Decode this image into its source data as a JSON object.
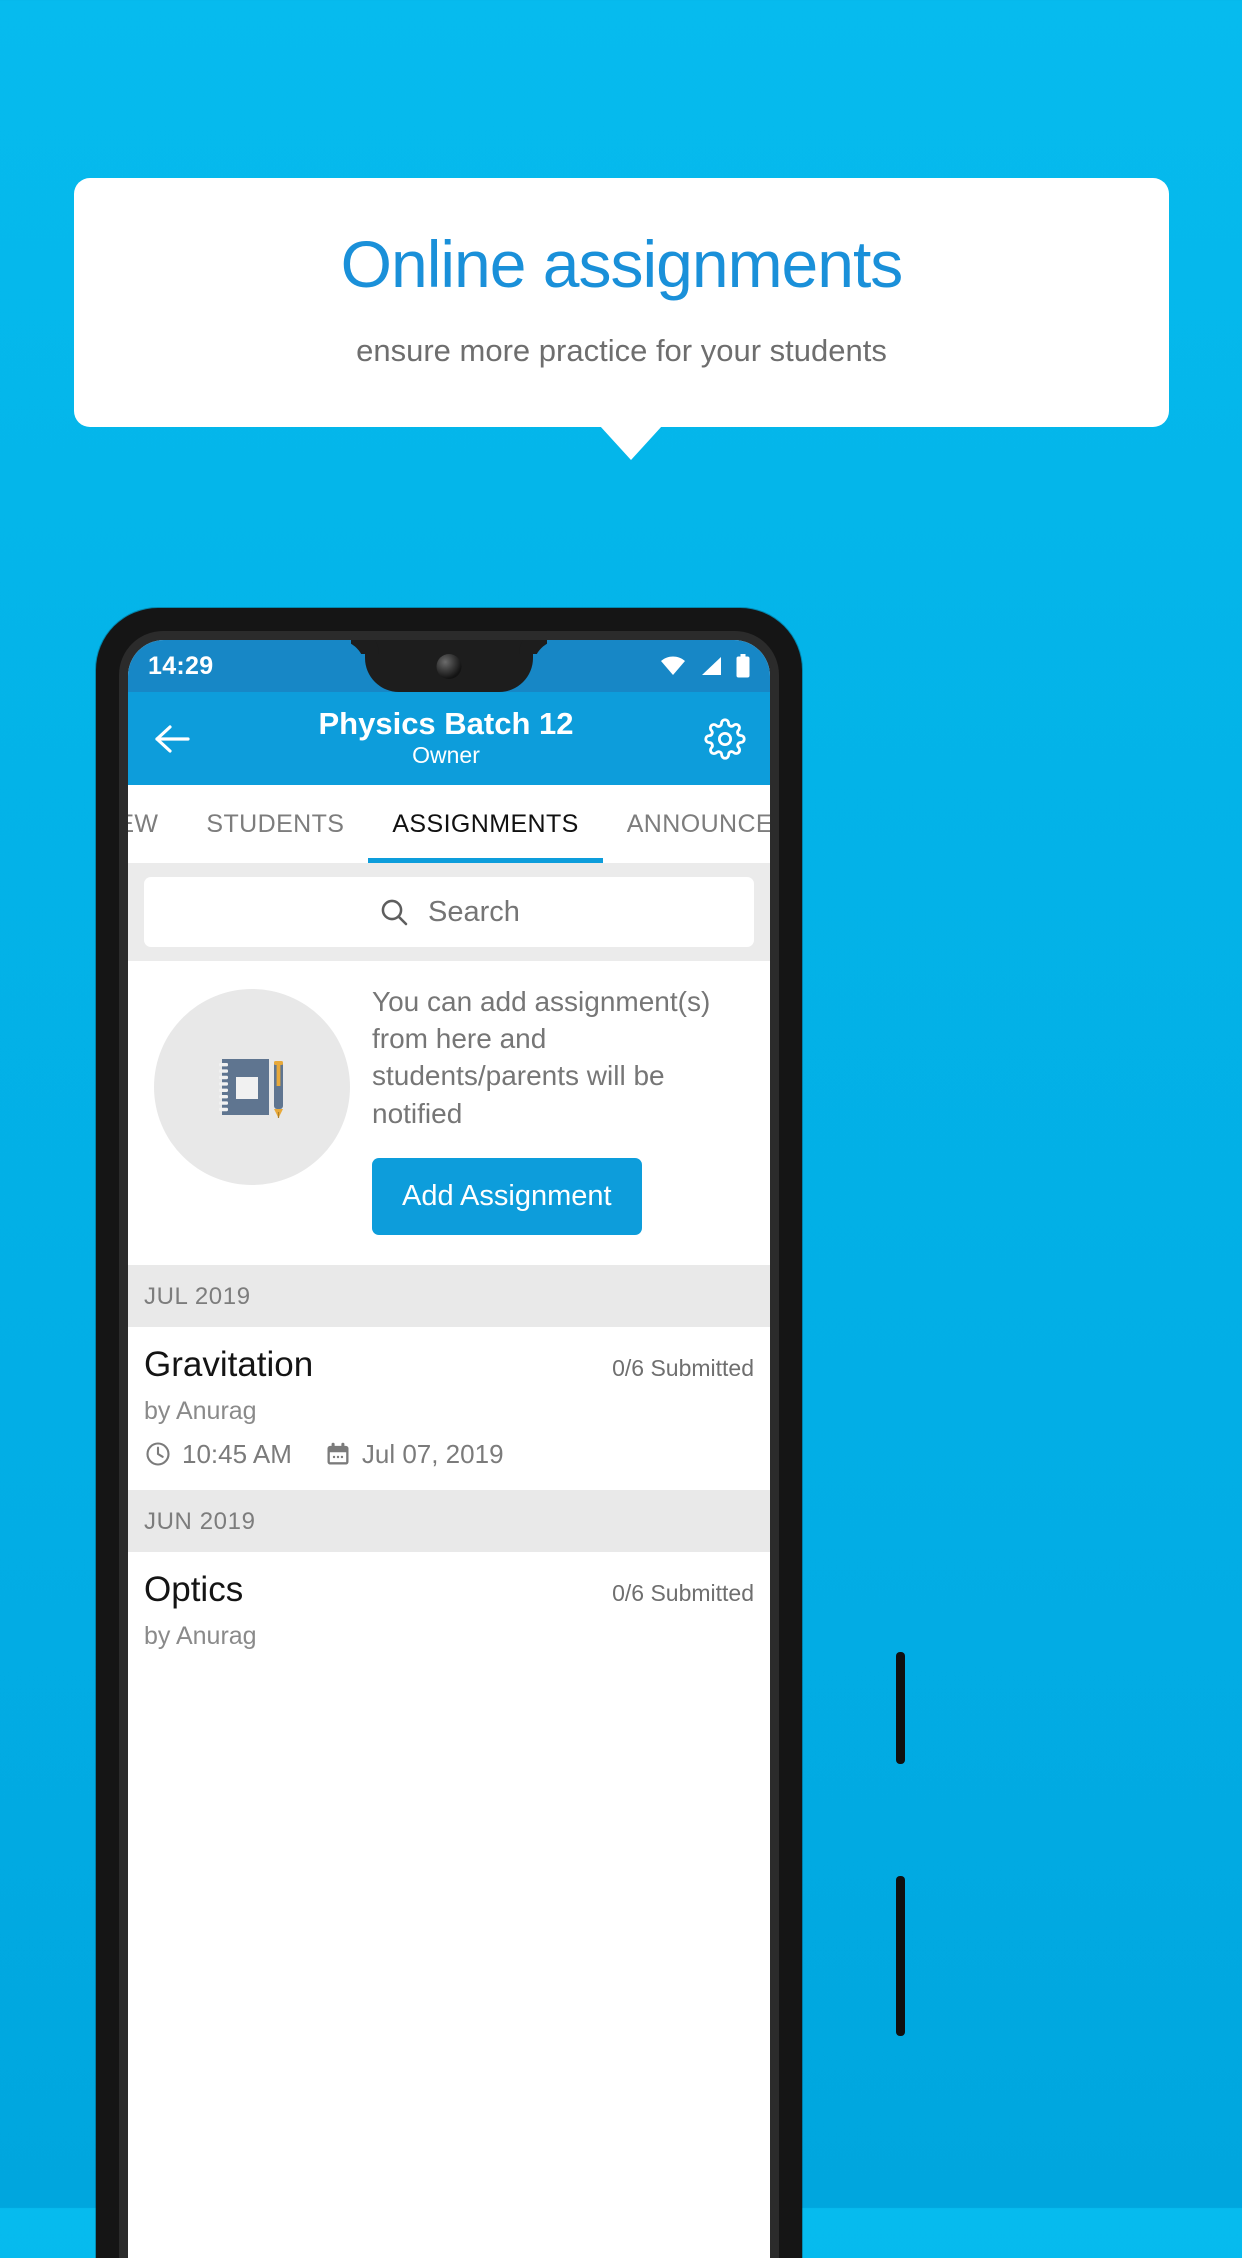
{
  "promo": {
    "title": "Online assignments",
    "subtitle": "ensure more practice for your students"
  },
  "colors": {
    "background": "#03b3e8",
    "accent": "#0d9ddb",
    "promo_title": "#1a90d9",
    "status_bar": "#1787c6",
    "section_header_bg": "#e9e9e9"
  },
  "phone": {
    "status_bar": {
      "time": "14:29",
      "icons": [
        "wifi-icon",
        "signal-icon",
        "battery-icon"
      ]
    },
    "app_bar": {
      "back_icon": "arrow-left-icon",
      "title": "Physics Batch 12",
      "subtitle": "Owner",
      "settings_icon": "gear-icon"
    },
    "tabs": [
      {
        "label": "IEW",
        "active": false
      },
      {
        "label": "STUDENTS",
        "active": false
      },
      {
        "label": "ASSIGNMENTS",
        "active": true
      },
      {
        "label": "ANNOUNCEM",
        "active": false
      }
    ],
    "search": {
      "icon": "search-icon",
      "placeholder": "Search",
      "value": ""
    },
    "empty_state": {
      "illustration_icon": "notebook-pen-icon",
      "text": "You can add assignment(s) from here and students/parents will be notified",
      "button_label": "Add Assignment"
    },
    "sections": [
      {
        "header": "JUL 2019",
        "items": [
          {
            "title": "Gravitation",
            "submitted": "0/6 Submitted",
            "author": "by Anurag",
            "time_icon": "clock-icon",
            "time": "10:45 AM",
            "date_icon": "calendar-icon",
            "date": "Jul 07, 2019"
          }
        ]
      },
      {
        "header": "JUN 2019",
        "items": [
          {
            "title": "Optics",
            "submitted": "0/6 Submitted",
            "author": "by Anurag",
            "time_icon": "clock-icon",
            "time": "",
            "date_icon": "calendar-icon",
            "date": ""
          }
        ]
      }
    ]
  }
}
